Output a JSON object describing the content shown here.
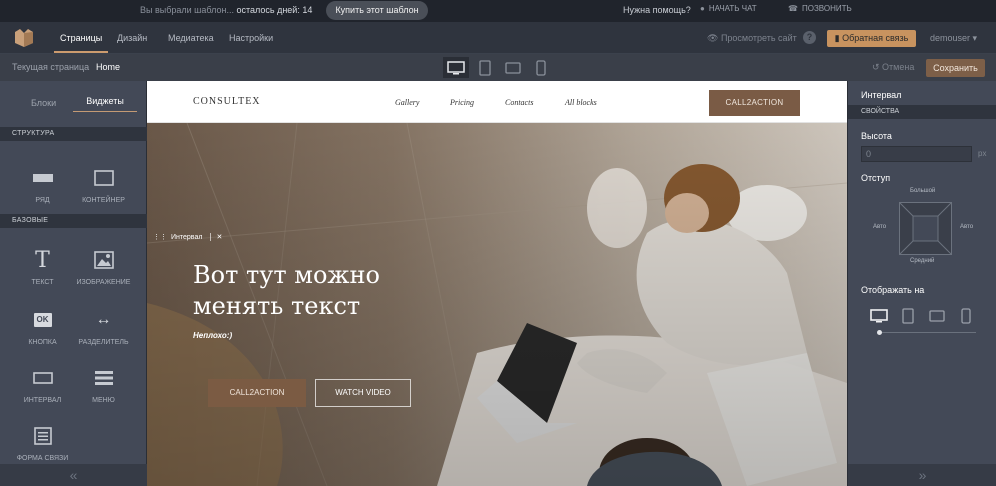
{
  "notice": {
    "text_prefix": "Вы выбрали шаблон...",
    "text_days": "осталось дней: 14",
    "buy_button": "Купить этот шаблон",
    "help": "Нужна помощь?",
    "chat": "НАЧАТЬ ЧАТ",
    "call": "ПОЗВОНИТЬ"
  },
  "menu": {
    "items": [
      "Страницы",
      "Дизайн",
      "Медиатека",
      "Настройки"
    ],
    "active": "Страницы",
    "preview": "Просмотреть сайт",
    "feedback": "Обратная связь",
    "user": "demouser"
  },
  "toolbar": {
    "current_page_label": "Текущая страница",
    "current_page": "Home",
    "devices": [
      "desktop-icon",
      "tablet-icon",
      "tablet-landscape-icon",
      "phone-icon"
    ],
    "undo": "Отмена",
    "save": "Сохранить"
  },
  "left_panel": {
    "tabs": [
      "Блоки",
      "Виджеты"
    ],
    "active_tab": "Виджеты",
    "section_structure": "СТРУКТУРА",
    "section_basic": "БАЗОВЫЕ",
    "structure_widgets": [
      {
        "label": "РЯД",
        "icon": "row-icon"
      },
      {
        "label": "КОНТЕЙНЕР",
        "icon": "container-icon"
      }
    ],
    "basic_widgets": [
      {
        "label": "ТЕКСТ",
        "icon": "text-icon"
      },
      {
        "label": "ИЗОБРАЖЕНИЕ",
        "icon": "image-icon"
      },
      {
        "label": "КНОПКА",
        "icon": "button-icon"
      },
      {
        "label": "РАЗДЕЛИТЕЛЬ",
        "icon": "divider-icon"
      },
      {
        "label": "ИНТЕРВАЛ",
        "icon": "interval-icon"
      },
      {
        "label": "МЕНЮ",
        "icon": "menu-icon"
      },
      {
        "label": "ФОРМА СВЯЗИ",
        "icon": "form-icon"
      }
    ],
    "button_icon_text": "OK"
  },
  "site": {
    "brand": "CONSULTEX",
    "nav": [
      "Gallery",
      "Pricing",
      "Contacts",
      "All blocks"
    ],
    "header_cta": "CALL2ACTION",
    "interval_tag": "Интервал",
    "hero_title_1": "Вот тут можно",
    "hero_title_2": "менять текст",
    "hero_sub": "Неплохо:)",
    "hero_cta": "CALL2ACTION",
    "hero_watch": "WATCH VIDEO"
  },
  "right_panel": {
    "title": "Интервал",
    "section": "СВОЙСТВА",
    "height_label": "Высота",
    "height_value": "0",
    "height_unit": "px",
    "margin_label": "Отступ",
    "margin_top": "Большой",
    "margin_left": "Авто",
    "margin_right": "Авто",
    "margin_bottom": "Средний",
    "display_label": "Отображать на"
  },
  "colors": {
    "accent": "#c8935f",
    "cta_brown": "#7a5b45",
    "panel": "#434957",
    "dark_bar": "#2f343e"
  }
}
